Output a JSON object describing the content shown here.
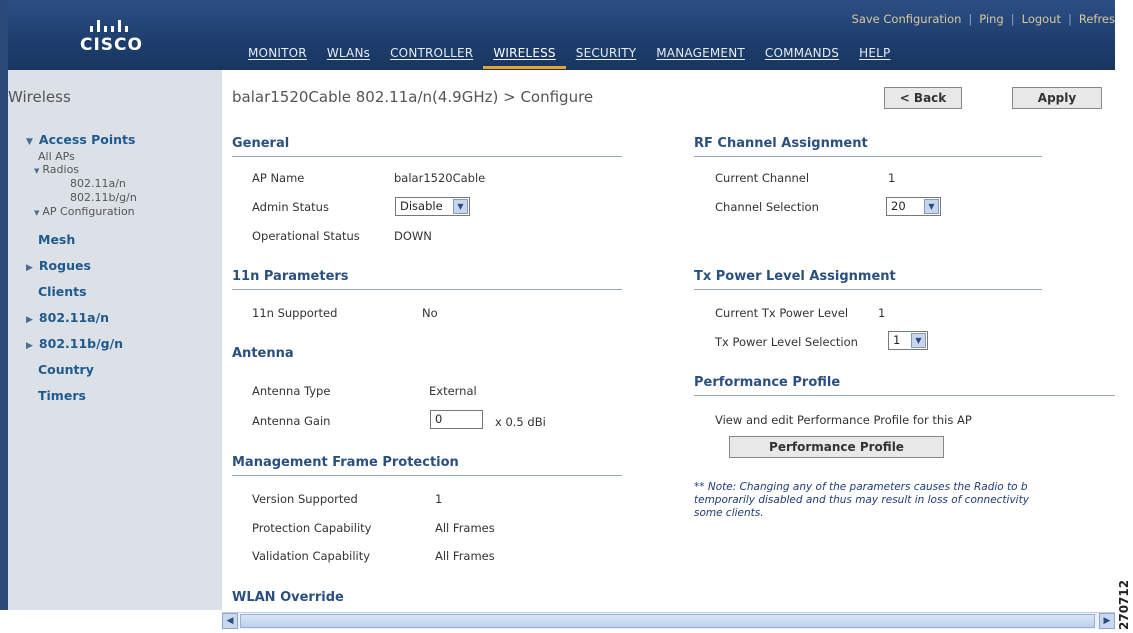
{
  "brand": "cisco",
  "top_links": [
    "Save Configuration",
    "Ping",
    "Logout",
    "Refres"
  ],
  "main_menu": [
    "MONITOR",
    "WLANs",
    "CONTROLLER",
    "WIRELESS",
    "SECURITY",
    "MANAGEMENT",
    "COMMANDS",
    "HELP"
  ],
  "active_menu": "WIRELESS",
  "sidebar": {
    "title": "Wireless",
    "access_points": "Access Points",
    "all_aps": "All APs",
    "radios": "Radios",
    "radio_a": "802.11a/n",
    "radio_bg": "802.11b/g/n",
    "ap_config": "AP Configuration",
    "mesh": "Mesh",
    "rogues": "Rogues",
    "clients": "Clients",
    "dot11a": "802.11a/n",
    "dot11bg": "802.11b/g/n",
    "country": "Country",
    "timers": "Timers"
  },
  "page": {
    "title": "balar1520Cable 802.11a/n(4.9GHz) > Configure",
    "back_button": "< Back",
    "apply_button": "Apply"
  },
  "general": {
    "header": "General",
    "ap_name_label": "AP Name",
    "ap_name_value": "balar1520Cable",
    "admin_status_label": "Admin Status",
    "admin_status_value": "Disable",
    "oper_status_label": "Operational Status",
    "oper_status_value": "DOWN"
  },
  "n_params": {
    "header": "11n Parameters",
    "supported_label": "11n Supported",
    "supported_value": "No"
  },
  "antenna": {
    "header": "Antenna",
    "type_label": "Antenna Type",
    "type_value": "External",
    "gain_label": "Antenna Gain",
    "gain_value": "0",
    "gain_unit": "x 0.5 dBi"
  },
  "mfp": {
    "header": "Management Frame Protection",
    "version_label": "Version Supported",
    "version_value": "1",
    "protection_label": "Protection Capability",
    "protection_value": "All Frames",
    "validation_label": "Validation Capability",
    "validation_value": "All Frames"
  },
  "wlan_override": {
    "header": "WLAN Override"
  },
  "rf_channel": {
    "header": "RF Channel Assignment",
    "current_label": "Current Channel",
    "current_value": "1",
    "selection_label": "Channel Selection",
    "selection_value": "20"
  },
  "tx_power": {
    "header": "Tx Power Level Assignment",
    "current_label": "Current Tx Power Level",
    "current_value": "1",
    "selection_label": "Tx Power Level Selection",
    "selection_value": "1"
  },
  "perf_profile": {
    "header": "Performance Profile",
    "description": "View and edit Performance Profile for this AP",
    "button": "Performance Profile"
  },
  "note": {
    "line1": "** Note: Changing any of the parameters causes the Radio to b",
    "line2": "temporarily disabled and thus may result in loss of connectivity",
    "line3": "some clients."
  },
  "figure_id": "270712"
}
